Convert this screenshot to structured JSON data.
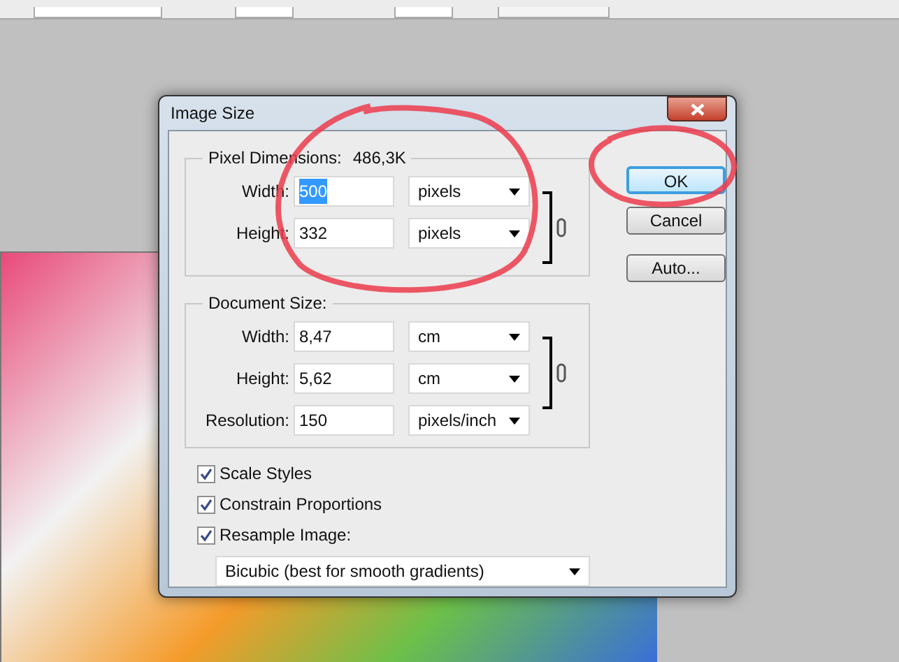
{
  "dialog": {
    "title": "Image Size",
    "pixel_dimensions": {
      "label": "Pixel Dimensions:",
      "value": "486,3K",
      "linked": true,
      "fields": [
        {
          "label": "Width:",
          "value": "500",
          "unit": "pixels",
          "selected": true
        },
        {
          "label": "Height:",
          "value": "332",
          "unit": "pixels",
          "selected": false
        }
      ]
    },
    "document_size": {
      "label": "Document Size:",
      "linked": true,
      "fields": [
        {
          "label": "Width:",
          "value": "8,47",
          "unit": "cm",
          "selected": false
        },
        {
          "label": "Height:",
          "value": "5,62",
          "unit": "cm",
          "selected": false
        },
        {
          "label": "Resolution:",
          "value": "150",
          "unit": "pixels/inch",
          "selected": false
        }
      ]
    },
    "checkboxes": [
      {
        "label": "Scale Styles",
        "checked": true
      },
      {
        "label": "Constrain Proportions",
        "checked": true
      },
      {
        "label": "Resample Image:",
        "checked": true
      }
    ],
    "resample_method": "Bicubic (best for smooth gradients)",
    "buttons": [
      {
        "label": "OK",
        "default": true
      },
      {
        "label": "Cancel",
        "default": false
      },
      {
        "label": "Auto...",
        "default": false
      }
    ]
  }
}
